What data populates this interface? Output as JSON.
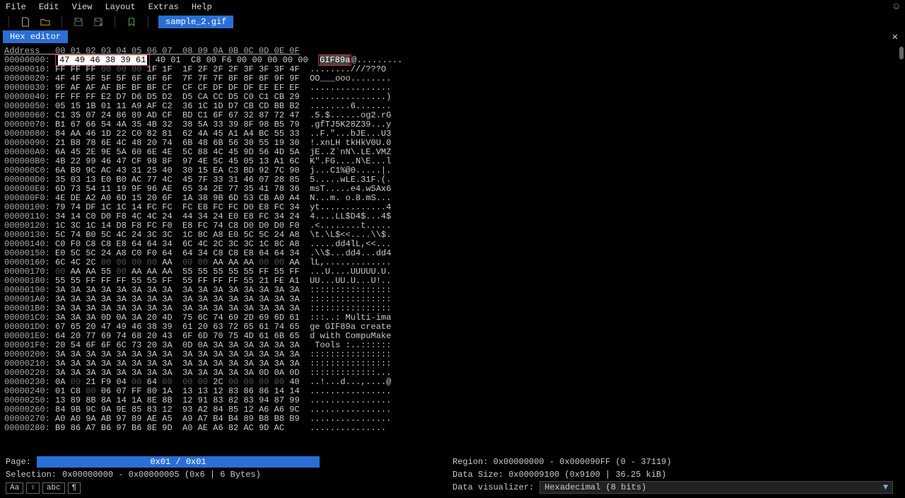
{
  "menubar": {
    "items": [
      "File",
      "Edit",
      "View",
      "Layout",
      "Extras",
      "Help"
    ]
  },
  "filename": "sample_2.gif",
  "tab": {
    "title": "Hex editor"
  },
  "hex": {
    "header_label": "Address",
    "header_cols": "00 01 02 03 04 05 06 07  08 09 0A 0B 0C 0D 0E 0F",
    "selection_hex": "47 49 46 38 39 61",
    "selection_ascii": "GIF89a",
    "rows": [
      {
        "addr": "00000000:",
        "hex_pre": "",
        "hex_sel": "47 49 46 38 39 61",
        "hex_post": " 40 01  C8 00 F6 00 00 00 00 00  ",
        "ascii_pre": "",
        "ascii_sel": "GIF89a",
        "ascii_post": "@........."
      },
      {
        "addr": "00000010:",
        "hex": "FF FF FF 00 00 00 1F 1F  1F 2F 2F 2F 3F 3F 3F 4F  ",
        "ascii": "........///???O"
      },
      {
        "addr": "00000020:",
        "hex": "4F 4F 5F 5F 5F 6F 6F 6F  7F 7F 7F 8F 8F 8F 9F 9F  ",
        "ascii": "OO___ooo........"
      },
      {
        "addr": "00000030:",
        "hex": "9F AF AF AF BF BF BF CF  CF CF DF DF DF EF EF EF  ",
        "ascii": "................"
      },
      {
        "addr": "00000040:",
        "hex": "FF FF FF E2 D7 D6 D5 D2  D5 CA CC D5 C0 C1 CB 29  ",
        "ascii": "...............)"
      },
      {
        "addr": "00000050:",
        "hex": "05 15 1B 01 11 A9 AF C2  36 1C 1D D7 CB CD BB B2  ",
        "ascii": "........6......."
      },
      {
        "addr": "00000060:",
        "hex": "C1 35 07 24 86 89 AD CF  BD C1 6F 67 32 87 72 47  ",
        "ascii": ".5.$......og2.rG"
      },
      {
        "addr": "00000070:",
        "hex": "B1 67 66 54 4A 35 4B 32  38 5A 33 39 8F 98 B5 79  ",
        "ascii": ".gfTJ5K28Z39...y"
      },
      {
        "addr": "00000080:",
        "hex": "84 AA 46 1D 22 C0 82 81  62 4A 45 A1 A4 BC 55 33  ",
        "ascii": "..F.\"...bJE...U3"
      },
      {
        "addr": "00000090:",
        "hex": "21 B8 78 6E 4C 48 20 74  6B 48 6B 56 30 55 19 30  ",
        "ascii": "!.xnLH tkHkV0U.0"
      },
      {
        "addr": "000000A0:",
        "hex": "6A 45 2E 9E 5A 60 6E 4E  5C 88 4C 45 9D 56 4D 5A  ",
        "ascii": "jE..Z`nN\\.LE.VMZ"
      },
      {
        "addr": "000000B0:",
        "hex": "4B 22 99 46 47 CF 98 8F  97 4E 5C 45 05 13 A1 6C  ",
        "ascii": "K\".FG....N\\E...l"
      },
      {
        "addr": "000000C0:",
        "hex": "6A B0 9C AC 43 31 25 40  30 15 EA C3 BD 92 7C 90  ",
        "ascii": "j...C1%@0.....|."
      },
      {
        "addr": "000000D0:",
        "hex": "35 03 13 E0 B0 AC 77 4C  45 7F 33 31 46 07 28 85  ",
        "ascii": "5.....wLE.31F.(."
      },
      {
        "addr": "000000E0:",
        "hex": "6D 73 54 11 19 9F 96 AE  65 34 2E 77 35 41 78 36  ",
        "ascii": "msT.....e4.w5Ax6"
      },
      {
        "addr": "000000F0:",
        "hex": "4E DE A2 A0 6D 15 20 6F  1A 38 9B 6D 53 CB A0 A4  ",
        "ascii": "N...m. o.8.mS..."
      },
      {
        "addr": "00000100:",
        "hex": "79 74 DF 1C 1C 14 FC FC  FC E8 FC FC D0 E8 FC 34  ",
        "ascii": "yt.............4"
      },
      {
        "addr": "00000110:",
        "hex": "34 14 C0 D0 F8 4C 4C 24  44 34 24 E0 E8 FC 34 24  ",
        "ascii": "4....LL$D4$...4$"
      },
      {
        "addr": "00000120:",
        "hex": "1C 3C 1C 14 D8 F8 FC F0  E8 FC 74 C8 D0 D0 D0 F0  ",
        "ascii": ".<........t....."
      },
      {
        "addr": "00000130:",
        "hex": "5C 74 B0 5C 4C 24 3C 3C  1C 8C A8 E0 5C 5C 24 A8  ",
        "ascii": "\\t.\\L$<<....\\\\$."
      },
      {
        "addr": "00000140:",
        "hex": "C0 F0 C8 C8 E8 64 64 34  6C 4C 2C 3C 3C 1C 8C A8  ",
        "ascii": ".....dd4lL,<<..."
      },
      {
        "addr": "00000150:",
        "hex": "E0 5C 5C 24 A8 C0 F0 64  64 34 C8 C8 E8 64 64 34  ",
        "ascii": ".\\\\$...dd4...dd4"
      },
      {
        "addr": "00000160:",
        "hex": "6C 4C 2C 00 00 00 00 AA  00 00 AA AA AA 00 00 AA  ",
        "ascii": "lL,............."
      },
      {
        "addr": "00000170:",
        "hex": "00 AA AA 55 00 AA AA AA  55 55 55 55 55 FF 55 FF  ",
        "ascii": "...U....UUUUU.U."
      },
      {
        "addr": "00000180:",
        "hex": "55 55 FF FF FF 55 55 FF  55 FF FF FF 55 21 FE A1  ",
        "ascii": "UU...UU.U...U!.."
      },
      {
        "addr": "00000190:",
        "hex": "3A 3A 3A 3A 3A 3A 3A 3A  3A 3A 3A 3A 3A 3A 3A 3A  ",
        "ascii": "::::::::::::::::"
      },
      {
        "addr": "000001A0:",
        "hex": "3A 3A 3A 3A 3A 3A 3A 3A  3A 3A 3A 3A 3A 3A 3A 3A  ",
        "ascii": "::::::::::::::::"
      },
      {
        "addr": "000001B0:",
        "hex": "3A 3A 3A 3A 3A 3A 3A 3A  3A 3A 3A 3A 3A 3A 3A 3A  ",
        "ascii": "::::::::::::::::"
      },
      {
        "addr": "000001C0:",
        "hex": "3A 3A 3A 0D 0A 3A 20 4D  75 6C 74 69 2D 69 6D 61  ",
        "ascii": ":::..: Multi-ima"
      },
      {
        "addr": "000001D0:",
        "hex": "67 65 20 47 49 46 38 39  61 20 63 72 65 61 74 65  ",
        "ascii": "ge GIF89a create"
      },
      {
        "addr": "000001E0:",
        "hex": "64 20 77 69 74 68 20 43  6F 6D 70 75 4D 61 6B 65  ",
        "ascii": "d with CompuMake"
      },
      {
        "addr": "000001F0:",
        "hex": "20 54 6F 6F 6C 73 20 3A  0D 0A 3A 3A 3A 3A 3A 3A  ",
        "ascii": " Tools :..::::::"
      },
      {
        "addr": "00000200:",
        "hex": "3A 3A 3A 3A 3A 3A 3A 3A  3A 3A 3A 3A 3A 3A 3A 3A  ",
        "ascii": "::::::::::::::::"
      },
      {
        "addr": "00000210:",
        "hex": "3A 3A 3A 3A 3A 3A 3A 3A  3A 3A 3A 3A 3A 3A 3A 3A  ",
        "ascii": "::::::::::::::::"
      },
      {
        "addr": "00000220:",
        "hex": "3A 3A 3A 3A 3A 3A 3A 3A  3A 3A 3A 3A 3A 0D 0A 0D  ",
        "ascii": ":::::::::::::..."
      },
      {
        "addr": "00000230:",
        "hex": "0A 00 21 F9 04 00 64 00  00 00 2C 00 00 00 00 40  ",
        "ascii": "..!...d...,....@"
      },
      {
        "addr": "00000240:",
        "hex": "01 C8 00 06 07 FF 80 1A  13 13 12 83 86 86 14 14  ",
        "ascii": "................"
      },
      {
        "addr": "00000250:",
        "hex": "13 89 8B 8A 14 1A 8E 8B  12 91 83 82 83 94 87 99  ",
        "ascii": "................"
      },
      {
        "addr": "00000260:",
        "hex": "84 9B 9C 9A 9E 85 83 12  93 A2 84 85 12 A6 A6 9C  ",
        "ascii": "................"
      },
      {
        "addr": "00000270:",
        "hex": "A0 A0 9A AB 97 89 AE A5  A9 A7 B4 B4 89 B8 B8 B9  ",
        "ascii": "................"
      },
      {
        "addr": "00000280:",
        "hex": "B9 86 A7 B6 97 B6 8E 9D  A0 AE A6 82 AC 9D AC     ",
        "ascii": "..............."
      }
    ]
  },
  "footer": {
    "page_label": "Page:",
    "page_value": "0x01 / 0x01",
    "selection_label": "Selection:",
    "selection_value": "0x00000000 - 0x00000005 (0x6 | 6 Bytes)",
    "region_label": "Region:",
    "region_value": "0x00000000 - 0x000090FF (0 - 37119)",
    "datasize_label": "Data Size:",
    "datasize_value": "0x00009100 (0x9100 | 36.25 kiB)",
    "visualizer_label": "Data visualizer:",
    "visualizer_value": "Hexadecimal (8 bits)",
    "buttons": [
      "Aa",
      "♀",
      "abc",
      "¶"
    ]
  }
}
